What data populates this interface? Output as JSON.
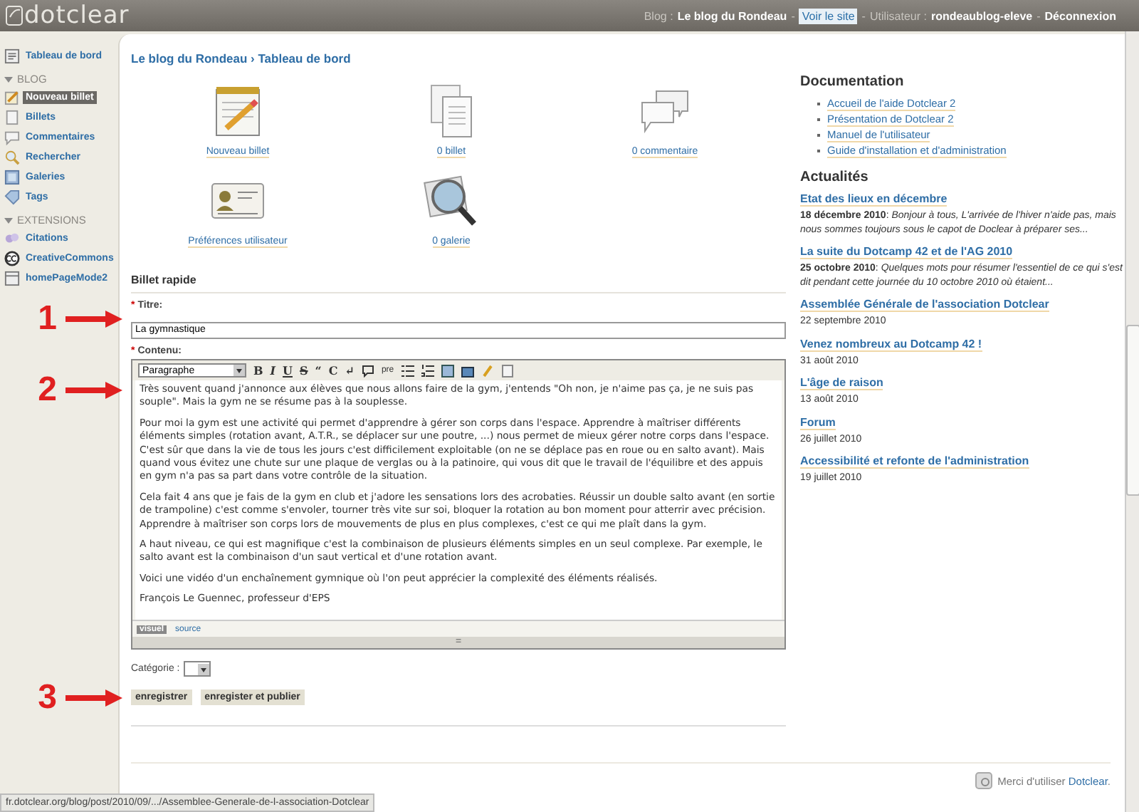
{
  "header": {
    "logo": "dotclear",
    "links": [
      {
        "kind": "label",
        "text": "Blog :"
      },
      {
        "kind": "strong",
        "text": "Le blog du Rondeau"
      },
      {
        "kind": "sep",
        "text": "-"
      },
      {
        "kind": "button",
        "text": "Voir le site"
      },
      {
        "kind": "sep",
        "text": "-"
      },
      {
        "kind": "label",
        "text": "Utilisateur :"
      },
      {
        "kind": "strong",
        "text": "rondeaublog-eleve"
      },
      {
        "kind": "sep",
        "text": "-"
      },
      {
        "kind": "strong",
        "text": "Déconnexion"
      }
    ]
  },
  "sidebar": {
    "top": {
      "label": "Tableau de bord",
      "kind": "dashboard"
    },
    "sections": [
      {
        "title": "BLOG",
        "expanded": true,
        "items": [
          {
            "label": "Nouveau billet",
            "kind": "edit",
            "selected": true
          },
          {
            "label": "Billets",
            "kind": "page",
            "selected": false
          },
          {
            "label": "Commentaires",
            "kind": "bubble",
            "selected": false
          },
          {
            "label": "Rechercher",
            "kind": "search",
            "selected": false
          },
          {
            "label": "Galeries",
            "kind": "gallery",
            "selected": false
          },
          {
            "label": "Tags",
            "kind": "tag",
            "selected": false
          }
        ]
      },
      {
        "title": "EXTENSIONS",
        "expanded": true,
        "items": [
          {
            "label": "Citations",
            "kind": "quote",
            "selected": false
          },
          {
            "label": "CreativeCommons",
            "kind": "cc",
            "selected": false
          },
          {
            "label": "homePageMode2",
            "kind": "home",
            "selected": false
          }
        ]
      }
    ]
  },
  "breadcrumb": "Le blog du Rondeau › Tableau de bord",
  "shortcuts": [
    {
      "label": "Nouveau billet",
      "kind": "notepad"
    },
    {
      "label": "0 billet",
      "kind": "documents"
    },
    {
      "label": "0 commentaire",
      "kind": "bubbles"
    },
    {
      "label": "Préférences utilisateur",
      "kind": "card"
    },
    {
      "label": "0 galerie",
      "kind": "magnifier"
    }
  ],
  "quick_post": {
    "heading": "Billet rapide",
    "required_mark": "*",
    "title_label": "Titre:",
    "title_value": "La gymnastique",
    "content_label": "Contenu:",
    "toolbar": {
      "format": "Paragraphe",
      "buttons": [
        "B",
        "I",
        "U",
        "S",
        "“",
        "C",
        "↵"
      ],
      "pre": "pre"
    },
    "paragraphs": [
      "Très souvent quand j'annonce aux élèves que nous allons faire de la gym, j'entends \"Oh non, je n'aime pas ça, je ne suis pas souple\". Mais la gym ne se résume pas à la souplesse.",
      "Pour moi la gym est une activité qui permet d'apprendre à gérer son corps dans l'espace. Apprendre à maîtriser différents éléments simples (rotation avant, A.T.R., se déplacer sur une poutre, ...) nous permet de mieux gérer notre corps dans l'espace. C'est sûr que dans la vie de tous les jours c'est difficilement exploitable (on ne se déplace pas en roue ou en salto avant). Mais quand vous évitez une chute sur une plaque de verglas ou à la patinoire, qui vous dit que le travail de l'équilibre et des appuis en gym n'a pas sa part dans votre contrôle de la situation.",
      "Cela fait 4 ans que je fais de la gym en club et j'adore les sensations lors des acrobaties. Réussir un double salto avant (en sortie de trampoline) c'est comme s'envoler, tourner très vite sur soi, bloquer la rotation au bon moment pour atterrir avec précision. Apprendre à maîtriser son corps lors de mouvements de plus en plus complexes, c'est ce qui me plaît dans la gym.",
      "A haut niveau, ce qui est magnifique c'est la combinaison de plusieurs éléments simples en un seul complexe. Par exemple, le salto avant est la combinaison d'un saut vertical et d'une rotation avant.",
      "Voici une vidéo d'un enchaînement gymnique où l'on peut apprécier la complexité des éléments réalisés.",
      "François Le Guennec, professeur d'EPS"
    ],
    "modes": [
      {
        "label": "visuel",
        "selected": true
      },
      {
        "label": "source",
        "selected": false
      }
    ],
    "resize_handle": "=",
    "category_label": "Catégorie :",
    "buttons": [
      "enregistrer",
      "enregister et publier"
    ]
  },
  "annotations": [
    {
      "label": "1"
    },
    {
      "label": "2"
    },
    {
      "label": "3"
    }
  ],
  "documentation": {
    "heading": "Documentation",
    "links": [
      "Accueil de l'aide Dotclear 2",
      "Présentation de Dotclear 2",
      "Manuel de l'utilisateur",
      "Guide d'installation et d'administration"
    ]
  },
  "news": {
    "heading": "Actualités",
    "items": [
      {
        "title": "Etat des lieux en décembre",
        "meta": "**18 décembre 2010**: *Bonjour à tous, L'arrivée de l'hiver n'aide pas, mais nous sommes toujours sous le capot de Doclear à préparer ses...*"
      },
      {
        "title": "La suite du Dotcamp 42 et de l'AG 2010",
        "meta": "**25 octobre 2010**: *Quelques mots pour résumer l'essentiel de ce qui s'est dit pendant cette journée du 10 octobre 2010 où étaient...*"
      },
      {
        "title": "Assemblée Générale de l'association Dotclear",
        "meta": "22 septembre 2010"
      },
      {
        "title": "Venez nombreux au Dotcamp 42 !",
        "meta": "31 août 2010"
      },
      {
        "title": "L'âge de raison",
        "meta": "13 août 2010"
      },
      {
        "title": "Forum",
        "meta": "26 juillet 2010"
      },
      {
        "title": "Accessibilité et refonte de l'administration",
        "meta": "19 juillet 2010"
      }
    ]
  },
  "footer": {
    "text": "Merci d'utiliser",
    "link": "Dotclear",
    "end": "."
  },
  "status_url": "fr.dotclear.org/blog/post/2010/09/.../Assemblee-Generale-de-l-association-Dotclear"
}
